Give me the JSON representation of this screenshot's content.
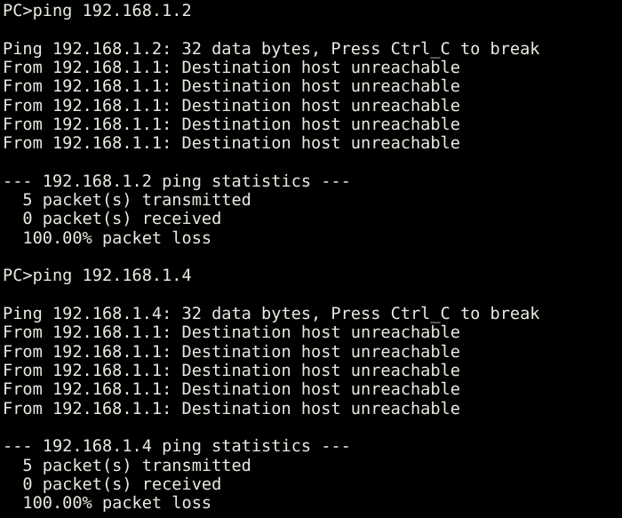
{
  "terminal": {
    "background_color": "#000000",
    "text_color": "#e9e9e1",
    "prompt": "PC>",
    "lines": [
      "PC>ping 192.168.1.2",
      "",
      "Ping 192.168.1.2: 32 data bytes, Press Ctrl_C to break",
      "From 192.168.1.1: Destination host unreachable",
      "From 192.168.1.1: Destination host unreachable",
      "From 192.168.1.1: Destination host unreachable",
      "From 192.168.1.1: Destination host unreachable",
      "From 192.168.1.1: Destination host unreachable",
      "",
      "--- 192.168.1.2 ping statistics ---",
      "  5 packet(s) transmitted",
      "  0 packet(s) received",
      "  100.00% packet loss",
      "",
      "PC>ping 192.168.1.4",
      "",
      "Ping 192.168.1.4: 32 data bytes, Press Ctrl_C to break",
      "From 192.168.1.1: Destination host unreachable",
      "From 192.168.1.1: Destination host unreachable",
      "From 192.168.1.1: Destination host unreachable",
      "From 192.168.1.1: Destination host unreachable",
      "From 192.168.1.1: Destination host unreachable",
      "",
      "--- 192.168.1.4 ping statistics ---",
      "  5 packet(s) transmitted",
      "  0 packet(s) received",
      "  100.00% packet loss"
    ],
    "sessions": [
      {
        "command": "ping 192.168.1.2",
        "target_ip": "192.168.1.2",
        "data_bytes": "32",
        "break_hint": "Press Ctrl_C to break",
        "replies": [
          {
            "from_ip": "192.168.1.1",
            "message": "Destination host unreachable"
          },
          {
            "from_ip": "192.168.1.1",
            "message": "Destination host unreachable"
          },
          {
            "from_ip": "192.168.1.1",
            "message": "Destination host unreachable"
          },
          {
            "from_ip": "192.168.1.1",
            "message": "Destination host unreachable"
          },
          {
            "from_ip": "192.168.1.1",
            "message": "Destination host unreachable"
          }
        ],
        "statistics": {
          "header": "--- 192.168.1.2 ping statistics ---",
          "transmitted": "5",
          "received": "0",
          "packet_loss": "100.00%"
        }
      },
      {
        "command": "ping 192.168.1.4",
        "target_ip": "192.168.1.4",
        "data_bytes": "32",
        "break_hint": "Press Ctrl_C to break",
        "replies": [
          {
            "from_ip": "192.168.1.1",
            "message": "Destination host unreachable"
          },
          {
            "from_ip": "192.168.1.1",
            "message": "Destination host unreachable"
          },
          {
            "from_ip": "192.168.1.1",
            "message": "Destination host unreachable"
          },
          {
            "from_ip": "192.168.1.1",
            "message": "Destination host unreachable"
          },
          {
            "from_ip": "192.168.1.1",
            "message": "Destination host unreachable"
          }
        ],
        "statistics": {
          "header": "--- 192.168.1.4 ping statistics ---",
          "transmitted": "5",
          "received": "0",
          "packet_loss": "100.00%"
        }
      }
    ]
  }
}
